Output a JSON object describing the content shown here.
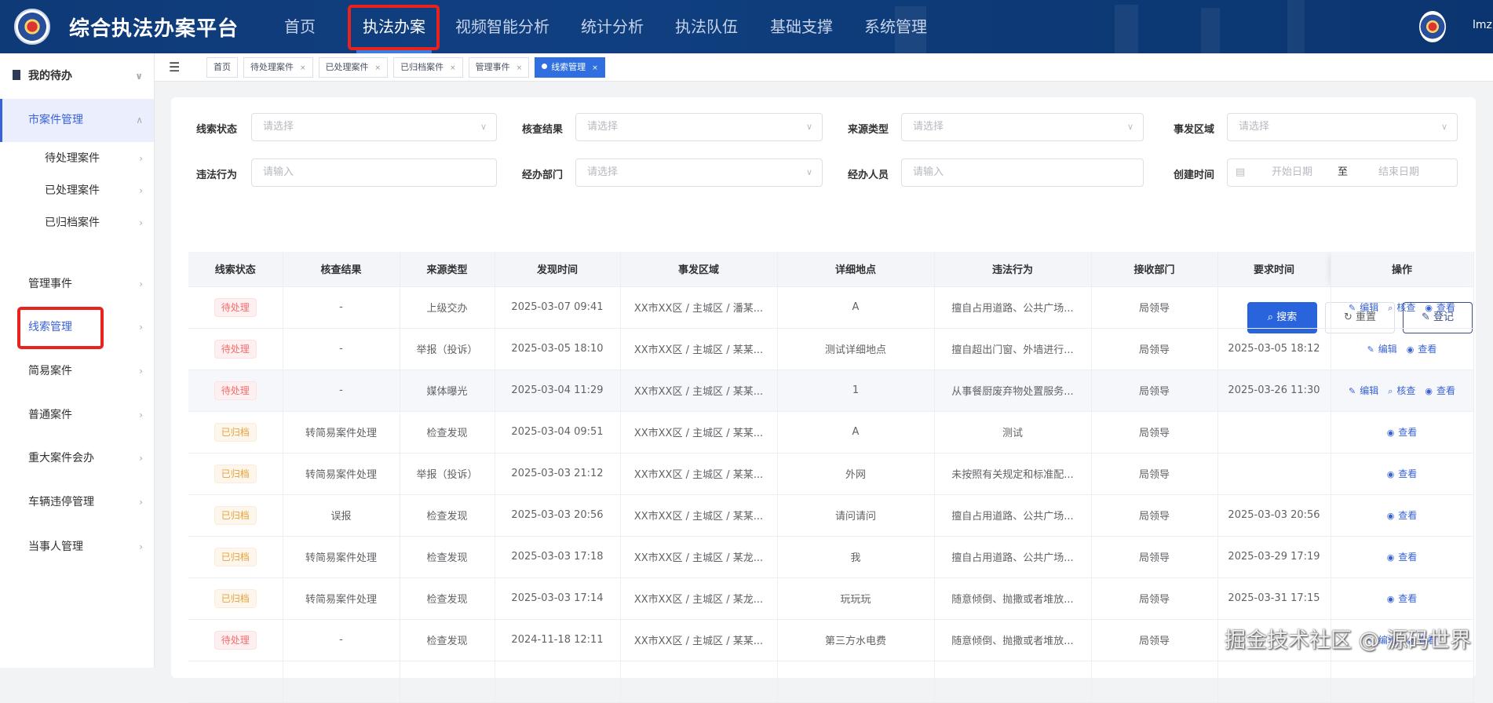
{
  "header": {
    "title": "综合执法办案平台",
    "user": "lmz",
    "nav": [
      {
        "label": "首页"
      },
      {
        "label": "执法办案",
        "active": true
      },
      {
        "label": "视频智能分析"
      },
      {
        "label": "统计分析"
      },
      {
        "label": "执法队伍"
      },
      {
        "label": "基础支撑"
      },
      {
        "label": "系统管理"
      }
    ]
  },
  "sidebar": {
    "top": "我的待办",
    "group": "市案件管理",
    "sub": [
      "待处理案件",
      "已处理案件",
      "已归档案件"
    ],
    "items": [
      "管理事件",
      "线索管理",
      "简易案件",
      "普通案件",
      "重大案件会办",
      "车辆违停管理",
      "当事人管理"
    ],
    "selected": "线索管理"
  },
  "tabs": [
    {
      "label": "首页",
      "closable": false
    },
    {
      "label": "待处理案件",
      "closable": true
    },
    {
      "label": "已处理案件",
      "closable": true
    },
    {
      "label": "已归档案件",
      "closable": true
    },
    {
      "label": "管理事件",
      "closable": true
    },
    {
      "label": "线索管理",
      "closable": true,
      "active": true
    }
  ],
  "filters": {
    "clue_status": {
      "label": "线索状态",
      "placeholder": "请选择"
    },
    "check_result": {
      "label": "核查结果",
      "placeholder": "请选择"
    },
    "source_type": {
      "label": "来源类型",
      "placeholder": "请选择"
    },
    "area": {
      "label": "事发区域",
      "placeholder": "请选择"
    },
    "violation": {
      "label": "违法行为",
      "placeholder": "请输入"
    },
    "dept": {
      "label": "经办部门",
      "placeholder": "请选择"
    },
    "handler": {
      "label": "经办人员",
      "placeholder": "请输入"
    },
    "created": {
      "label": "创建时间",
      "start": "开始日期",
      "sep": "至",
      "end": "结束日期"
    }
  },
  "buttons": {
    "search": "搜索",
    "reset": "重置",
    "register": "登记"
  },
  "table": {
    "columns": [
      "线索状态",
      "核查结果",
      "来源类型",
      "发现时间",
      "事发区域",
      "详细地点",
      "违法行为",
      "接收部门",
      "要求时间",
      "操作"
    ],
    "rows": [
      {
        "status": "待处理",
        "status_type": "pending",
        "result": "-",
        "source": "上级交办",
        "found": "2025-03-07 09:41",
        "area": "XX市XX区 / 主城区 / 潘某...",
        "place": "A",
        "violation": "擅自占用道路、公共广场...",
        "dept": "局领导",
        "due": "",
        "actions": [
          "编辑",
          "核查",
          "查看"
        ]
      },
      {
        "status": "待处理",
        "status_type": "pending",
        "result": "-",
        "source": "举报（投诉）",
        "found": "2025-03-05 18:10",
        "area": "XX市XX区 / 主城区 / 某某...",
        "place": "测试详细地点",
        "violation": "擅自超出门窗、外墙进行...",
        "dept": "局领导",
        "due": "2025-03-05 18:12",
        "actions": [
          "编辑",
          "查看"
        ]
      },
      {
        "status": "待处理",
        "status_type": "pending",
        "result": "-",
        "source": "媒体曝光",
        "found": "2025-03-04 11:29",
        "area": "XX市XX区 / 主城区 / 某某...",
        "place": "1",
        "violation": "从事餐厨废弃物处置服务...",
        "dept": "局领导",
        "due": "2025-03-26 11:30",
        "actions": [
          "编辑",
          "核查",
          "查看"
        ],
        "hover": true
      },
      {
        "status": "已归档",
        "status_type": "archived",
        "result": "转简易案件处理",
        "source": "检查发现",
        "found": "2025-03-04 09:51",
        "area": "XX市XX区 / 主城区 / 某某...",
        "place": "A",
        "violation": "测试",
        "dept": "局领导",
        "due": "",
        "actions": [
          "查看"
        ]
      },
      {
        "status": "已归档",
        "status_type": "archived",
        "result": "转简易案件处理",
        "source": "举报（投诉）",
        "found": "2025-03-03 21:12",
        "area": "XX市XX区 / 主城区 / 某某...",
        "place": "外网",
        "violation": "未按照有关规定和标准配...",
        "dept": "局领导",
        "due": "",
        "actions": [
          "查看"
        ]
      },
      {
        "status": "已归档",
        "status_type": "archived",
        "result": "误报",
        "source": "检查发现",
        "found": "2025-03-03 20:56",
        "area": "XX市XX区 / 主城区 / 某某...",
        "place": "请问请问",
        "violation": "擅自占用道路、公共广场...",
        "dept": "局领导",
        "due": "2025-03-03 20:56",
        "actions": [
          "查看"
        ]
      },
      {
        "status": "已归档",
        "status_type": "archived",
        "result": "转简易案件处理",
        "source": "检查发现",
        "found": "2025-03-03 17:18",
        "area": "XX市XX区 / 主城区 / 某龙...",
        "place": "我",
        "violation": "擅自占用道路、公共广场...",
        "dept": "局领导",
        "due": "2025-03-29 17:19",
        "actions": [
          "查看"
        ]
      },
      {
        "status": "已归档",
        "status_type": "archived",
        "result": "转简易案件处理",
        "source": "检查发现",
        "found": "2025-03-03 17:14",
        "area": "XX市XX区 / 主城区 / 某龙...",
        "place": "玩玩玩",
        "violation": "随意倾倒、抛撒或者堆放...",
        "dept": "局领导",
        "due": "2025-03-31 17:15",
        "actions": [
          "查看"
        ]
      },
      {
        "status": "待处理",
        "status_type": "pending",
        "result": "-",
        "source": "检查发现",
        "found": "2024-11-18 12:11",
        "area": "XX市XX区 / 主城区 / 某某...",
        "place": "第三方水电费",
        "violation": "随意倾倒、抛撒或者堆放...",
        "dept": "局领导",
        "due": "",
        "actions": [
          "编辑",
          "查看"
        ]
      }
    ]
  },
  "watermark": "掘金技术社区 @ 源码世界"
}
